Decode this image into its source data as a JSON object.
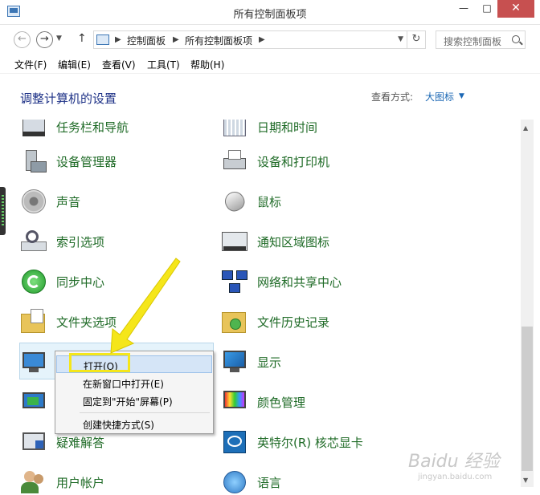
{
  "window": {
    "title": "所有控制面板项",
    "minimize": "—",
    "maximize": "□",
    "close": "✕"
  },
  "nav": {
    "back": "←",
    "forward": "→",
    "up": "↑",
    "breadcrumb": [
      "控制面板",
      "所有控制面板项"
    ],
    "search_placeholder": "搜索控制面板"
  },
  "menu": [
    "文件(F)",
    "编辑(E)",
    "查看(V)",
    "工具(T)",
    "帮助(H)"
  ],
  "header": {
    "title": "调整计算机的设置",
    "view_by_label": "查看方式:",
    "view_by_value": "大图标"
  },
  "items_left": [
    {
      "label": "任务栏和导航",
      "icon": "taskbar-icon"
    },
    {
      "label": "设备管理器",
      "icon": "device-manager-icon"
    },
    {
      "label": "声音",
      "icon": "speaker-icon"
    },
    {
      "label": "索引选项",
      "icon": "indexing-icon"
    },
    {
      "label": "同步中心",
      "icon": "sync-icon"
    },
    {
      "label": "文件夹选项",
      "icon": "folder-options-icon"
    },
    {
      "label": "",
      "icon": "personalization-icon"
    },
    {
      "label": "",
      "icon": "recovery-icon"
    },
    {
      "label": "疑难解答",
      "icon": "troubleshooting-icon"
    },
    {
      "label": "用户帐户",
      "icon": "user-accounts-icon"
    }
  ],
  "items_right": [
    {
      "label": "日期和时间",
      "icon": "calendar-icon"
    },
    {
      "label": "设备和打印机",
      "icon": "printer-icon"
    },
    {
      "label": "鼠标",
      "icon": "mouse-icon"
    },
    {
      "label": "通知区域图标",
      "icon": "notification-icon"
    },
    {
      "label": "网络和共享中心",
      "icon": "network-icon"
    },
    {
      "label": "文件历史记录",
      "icon": "file-history-icon"
    },
    {
      "label": "显示",
      "icon": "display-icon"
    },
    {
      "label": "颜色管理",
      "icon": "color-management-icon"
    },
    {
      "label": "英特尔(R) 核芯显卡",
      "icon": "intel-graphics-icon"
    },
    {
      "label": "语言",
      "icon": "language-icon"
    }
  ],
  "context_menu": {
    "open": "打开(O)",
    "open_new_window": "在新窗口中打开(E)",
    "pin_start": "固定到\"开始\"屏幕(P)",
    "create_shortcut": "创建快捷方式(S)"
  },
  "watermark": {
    "main": "Baidu 经验",
    "sub": "jingyan.baidu.com"
  },
  "colors": {
    "item_text": "#1f6b27",
    "title_text": "#1e3287",
    "link": "#1c68b5",
    "highlight": "#f5e61a"
  }
}
